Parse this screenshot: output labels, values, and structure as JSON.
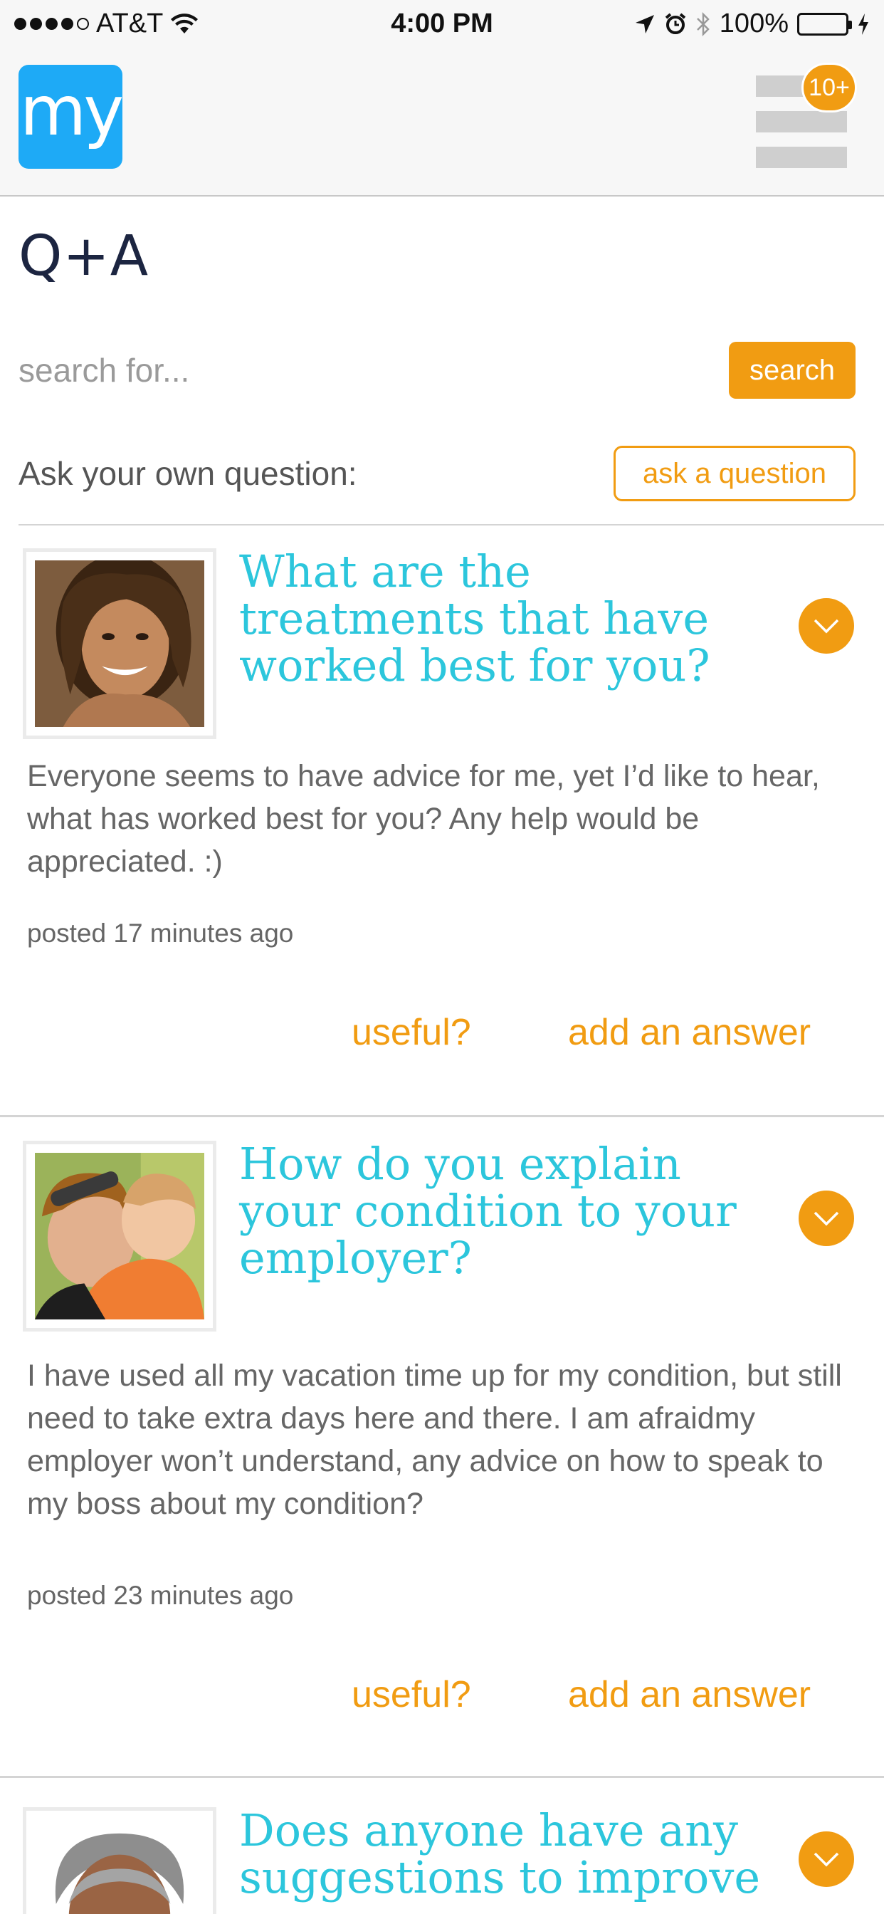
{
  "status_bar": {
    "carrier": "AT&T",
    "time": "4:00 PM",
    "battery": "100%"
  },
  "header": {
    "logo_text": "my",
    "notification_badge": "10+"
  },
  "page": {
    "title": "Q+A"
  },
  "search": {
    "placeholder": "search for...",
    "button_label": "search"
  },
  "ask": {
    "label": "Ask your own question:",
    "button_label": "ask a question"
  },
  "questions": [
    {
      "title": "What are the treatments that have worked best for you?",
      "body": "Everyone seems to have advice for me, yet I’d like to hear, what has worked best for you? Any help would be appreciated. :)",
      "posted": "posted 17 minutes ago",
      "useful_label": "useful?",
      "answer_label": "add an answer"
    },
    {
      "title": "How do you explain your condition to your employer?",
      "body": "I have used all my vacation time up for my condition, but still need to take extra days here and there.  I am afraidmy employer won’t understand, any advice on how to speak to my boss about my condition?",
      "posted": "posted 23 minutes ago",
      "useful_label": "useful?",
      "answer_label": "add an answer"
    },
    {
      "title": "Does anyone have any suggestions to improve",
      "body": "",
      "posted": "",
      "useful_label": "",
      "answer_label": ""
    }
  ],
  "colors": {
    "accent": "#f19c12",
    "title_blue": "#2cc6dc",
    "logo_blue": "#1eaaf6"
  }
}
